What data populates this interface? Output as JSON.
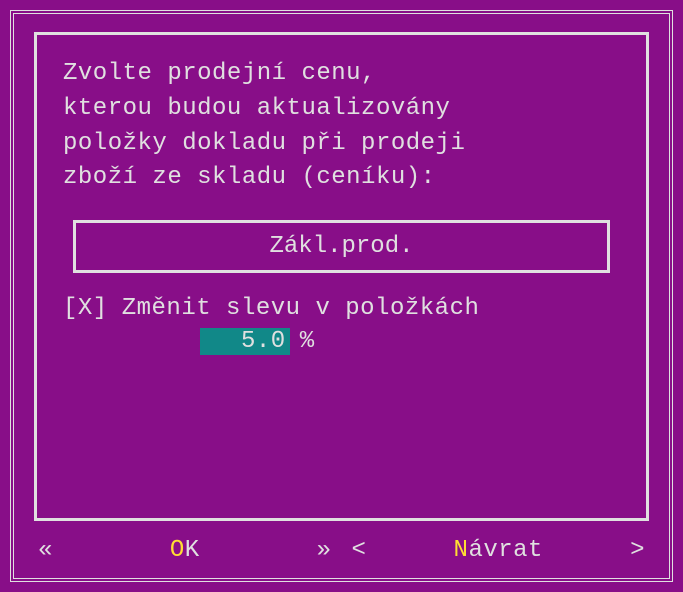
{
  "dialog": {
    "prompt": "Zvolte prodejní cenu,\nkterou budou aktualizovány\npoložky dokladu při prodeji\nzboží ze skladu (ceníku):",
    "price_option": "Zákl.prod.",
    "checkbox": {
      "mark": "[X]",
      "label": "Změnit slevu v položkách"
    },
    "discount": {
      "value": "5.0",
      "unit": "%"
    }
  },
  "buttons": {
    "ok": {
      "left": "«",
      "hotkey": "O",
      "rest": "K",
      "right": "»"
    },
    "return": {
      "left": "<",
      "hotkey": "N",
      "rest": "ávrat",
      "right": ">"
    }
  }
}
